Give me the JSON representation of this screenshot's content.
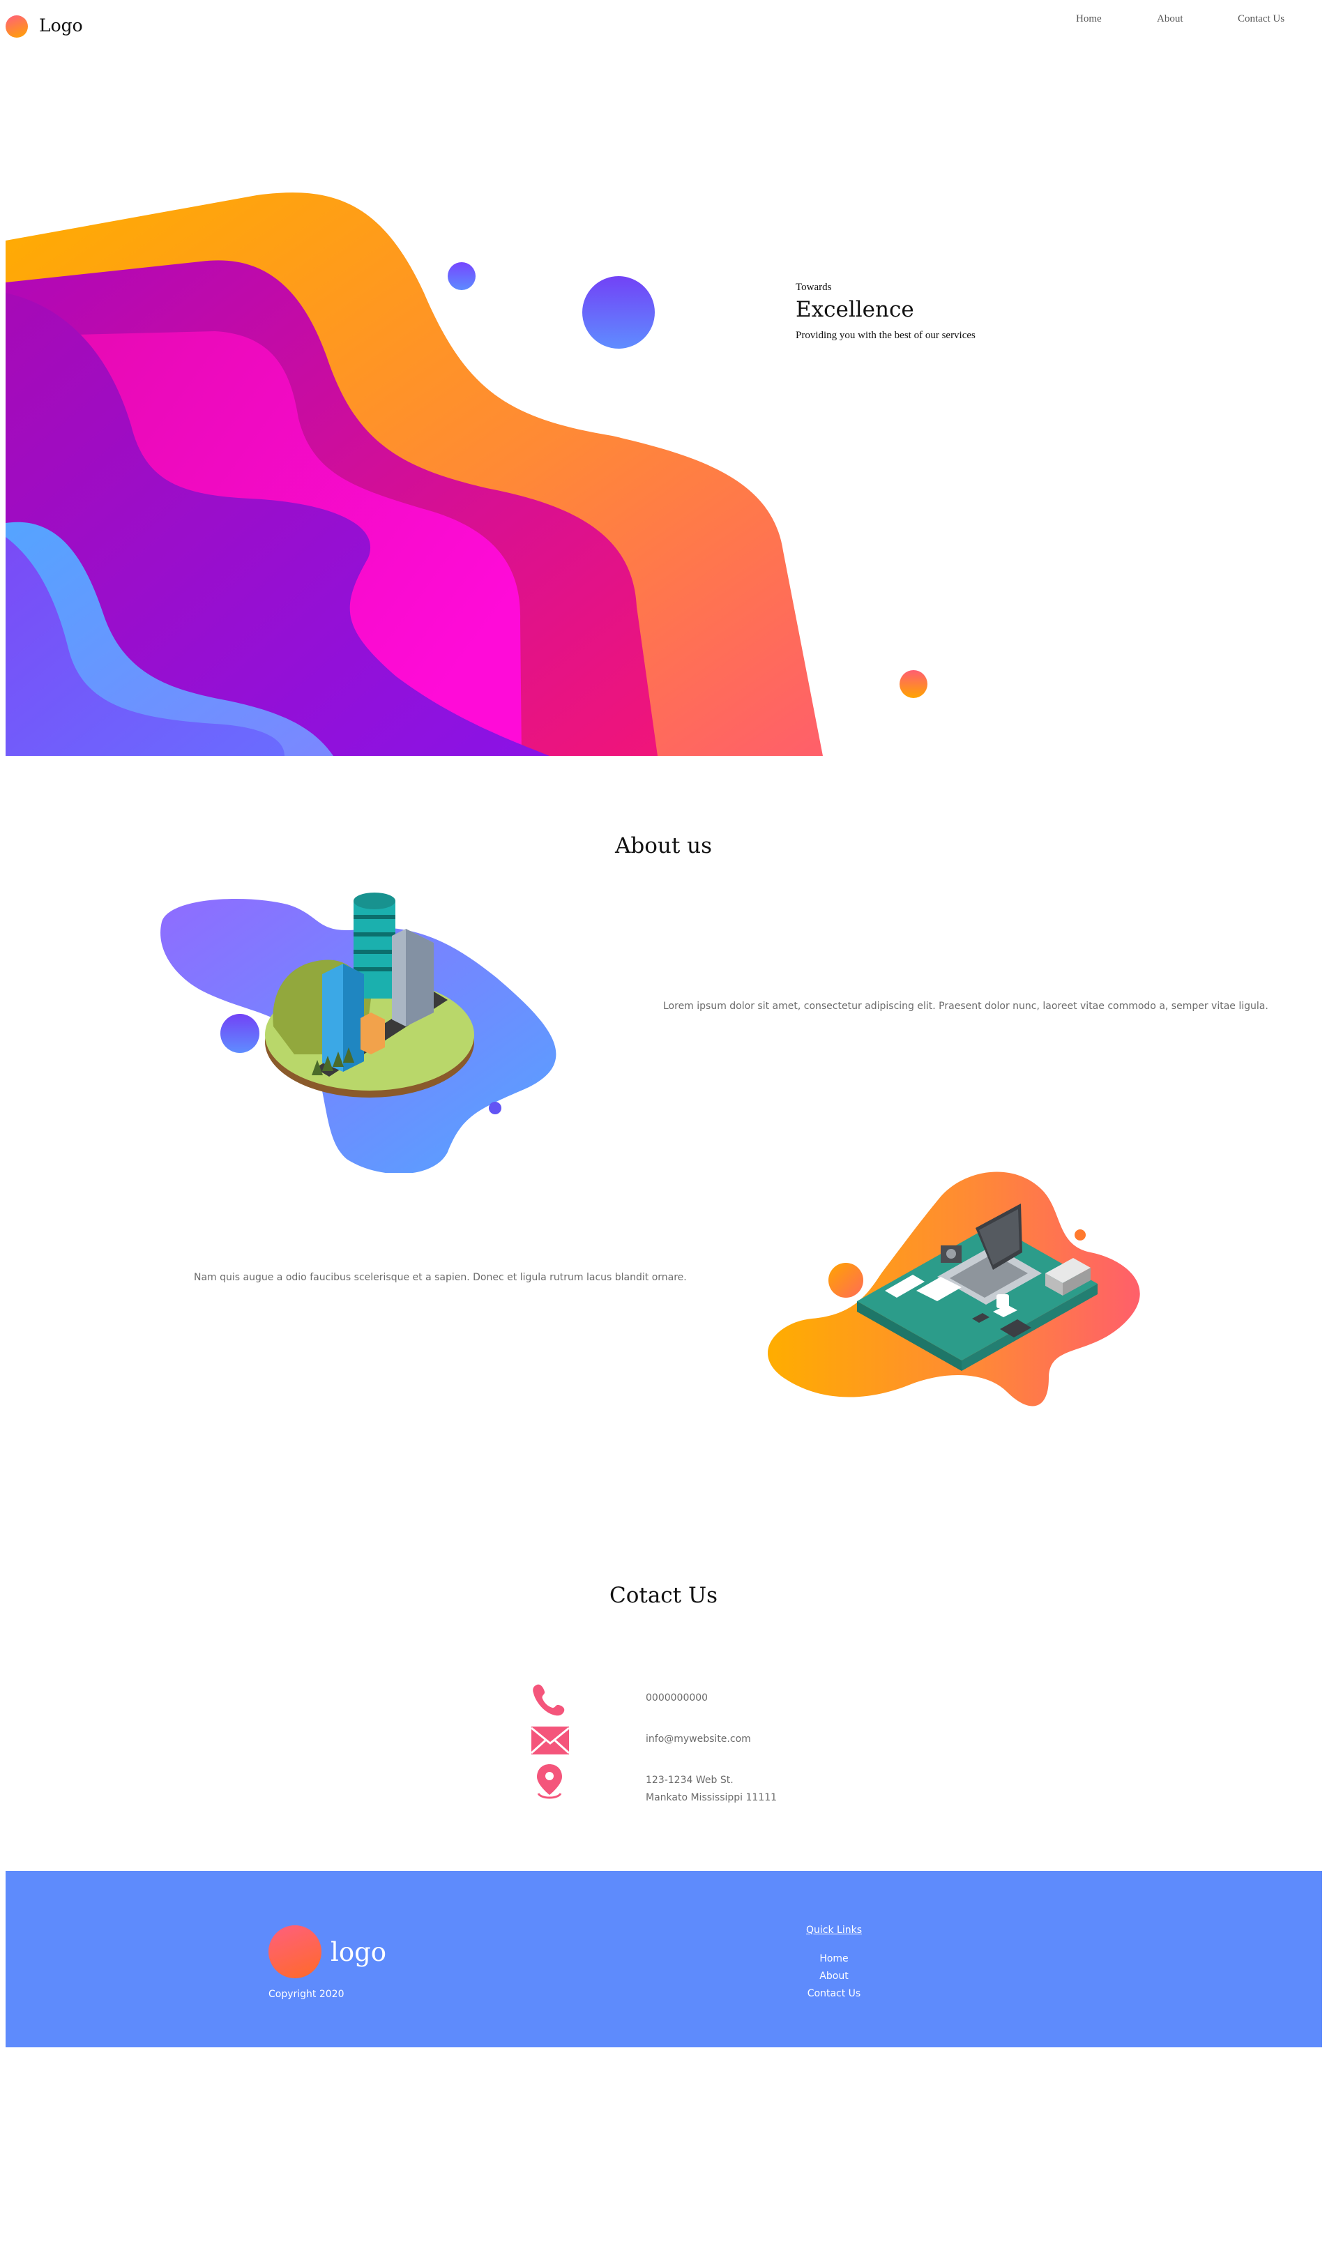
{
  "nav": {
    "logo_label": "Logo",
    "links": [
      "Home",
      "About",
      "Contact Us"
    ]
  },
  "hero": {
    "eyebrow": "Towards",
    "title": "Excellence",
    "subtitle": "Providing you with the best of our services"
  },
  "about": {
    "title": "About us",
    "paragraph_1": "Lorem ipsum dolor sit amet, consectetur adipiscing elit. Praesent dolor nunc, laoreet vitae commodo a, semper vitae ligula.",
    "paragraph_2": "Nam quis augue a odio faucibus scelerisque et a sapien. Donec et ligula rutrum lacus blandit ornare."
  },
  "contact": {
    "title": "Cotact Us",
    "phone": "0000000000",
    "email": "info@mywebsite.com",
    "address_line_1": "123-1234 Web St.",
    "address_line_2": "Mankato Mississippi 11111",
    "icons": [
      "phone-icon",
      "mail-icon",
      "location-pin-icon"
    ],
    "icon_color": "#f4557b"
  },
  "footer": {
    "logo_label": "logo",
    "copyright": "Copyright 2020",
    "quick_links_title": "Quick Links",
    "quick_links": [
      "Home",
      "About",
      "Contact Us"
    ],
    "background": "#5e8bfc"
  },
  "colors": {
    "accent_orange": "#ffa400",
    "accent_pink": "#ff5f7e",
    "accent_purple": "#7646ff",
    "accent_blue": "#5e8bfc"
  }
}
